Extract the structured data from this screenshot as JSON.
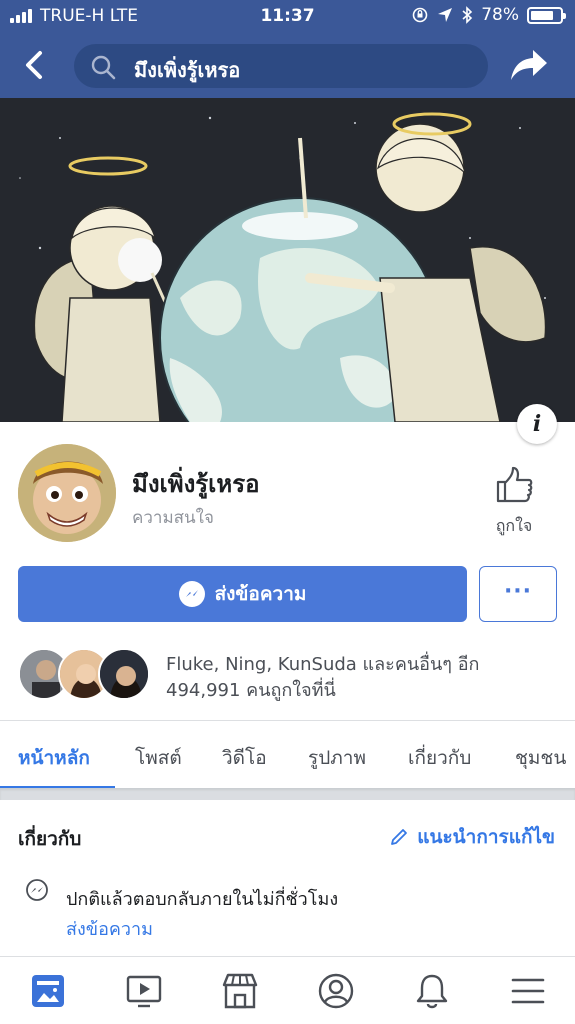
{
  "status_bar": {
    "carrier": "TRUE-H  LTE",
    "time": "11:37",
    "battery": "78%",
    "battery_level": 0.78
  },
  "nav": {
    "search_text": "มึงเพิ่งรู้เหรอ"
  },
  "page": {
    "name": "มึงเพิ่งรู้เหรอ",
    "category": "ความสนใจ",
    "like_label": "ถูกใจ",
    "message_label": "ส่งข้อความ",
    "more_label": "···",
    "info_label": "i"
  },
  "social": {
    "text": "Fluke, Ning, KunSuda และคนอื่นๆ อีก 494,991 คนถูกใจที่นี่"
  },
  "tabs": [
    {
      "label": "หน้าหลัก",
      "active": true
    },
    {
      "label": "โพสต์",
      "active": false
    },
    {
      "label": "วิดีโอ",
      "active": false
    },
    {
      "label": "รูปภาพ",
      "active": false
    },
    {
      "label": "เกี่ยวกับ",
      "active": false
    },
    {
      "label": "ชุมชน",
      "active": false
    }
  ],
  "about": {
    "title": "เกี่ยวกับ",
    "suggest_edit": "แนะนำการแก้ไข",
    "response_text": "ปกติแล้วตอบกลับภายในไม่กี่ชั่วโมง",
    "response_link": "ส่งข้อความ"
  },
  "bottom_bar": {
    "icons": [
      "news-feed-icon",
      "watch-video-icon",
      "marketplace-icon",
      "profile-icon",
      "notifications-icon",
      "menu-icon"
    ]
  },
  "colors": {
    "brand_blue": "#3b5898",
    "button_blue": "#4a78d8",
    "link_blue": "#3578e5"
  }
}
